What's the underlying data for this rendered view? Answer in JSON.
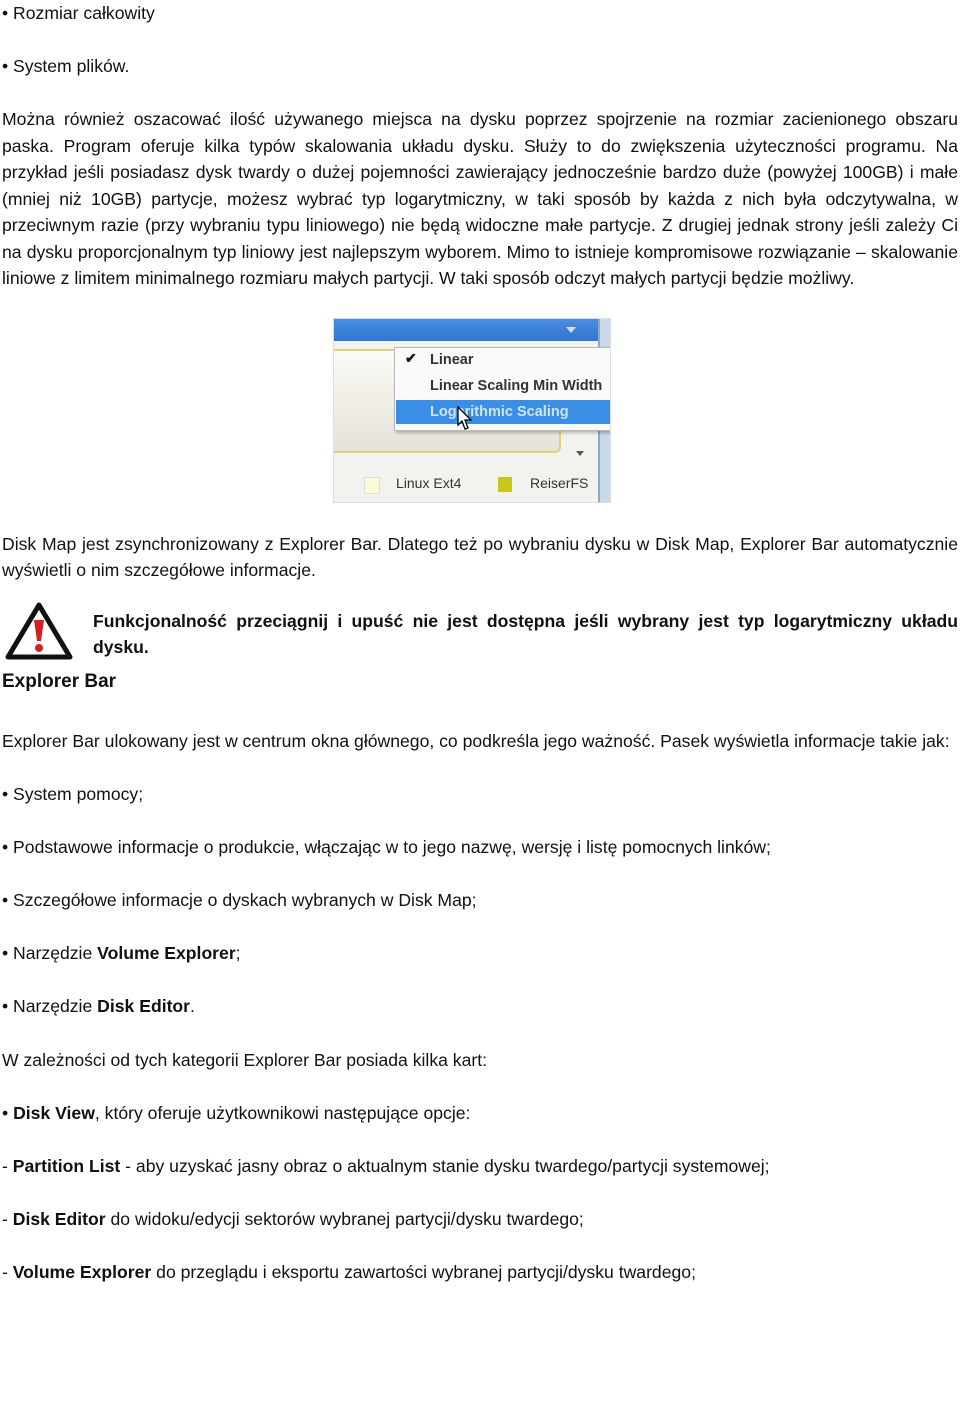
{
  "bullets_top": [
    "• Rozmiar całkowity",
    "• System plików."
  ],
  "para1": "Można również oszacować ilość używanego miejsca na dysku poprzez spojrzenie na rozmiar zacienionego obszaru paska. Program oferuje kilka typów skalowania układu dysku. Służy to do zwiększenia użyteczności programu. Na przykład jeśli posiadasz dysk twardy o dużej pojemności zawierający jednocześnie bardzo duże (powyżej 100GB) i małe (mniej niż 10GB) partycje, możesz wybrać typ logarytmiczny,  w taki sposób by każda z nich była odczytywalna, w przeciwnym razie (przy wybraniu typu liniowego) nie będą widoczne małe partycje. Z drugiej jednak strony jeśli zależy Ci na dysku proporcjonalnym typ liniowy jest najlepszym wyborem. Mimo to istnieje kompromisowe rozwiązanie – skalowanie liniowe z limitem minimalnego rozmiaru małych partycji. W taki sposób odczyt małych partycji będzie możliwy.",
  "figure": {
    "menu_items": [
      "Linear",
      "Linear Scaling Min Width",
      "Logarithmic Scaling"
    ],
    "checked_item": "Linear",
    "highlighted_item": "Logarithmic Scaling",
    "legend": [
      {
        "label": "Linux Ext4",
        "color": "#fbfbd8"
      },
      {
        "label": "ReiserFS",
        "color": "#c8c81a"
      }
    ]
  },
  "para2": "Disk Map jest zsynchronizowany z Explorer Bar. Dlatego też po wybraniu dysku w Disk Map, Explorer Bar automatycznie wyświetli o nim szczegółowe informacje.",
  "warning": "Funkcjonalność przeciągnij i upuść nie jest dostępna jeśli wybrany jest typ logarytmiczny układu dysku.",
  "heading": "Explorer Bar",
  "para3": "Explorer Bar ulokowany jest w centrum okna głównego, co podkreśla jego ważność. Pasek wyświetla informacje takie jak:",
  "list1": [
    {
      "pre": "• System pomocy;",
      "bold": "",
      "post": ""
    },
    {
      "pre": "• Podstawowe informacje o produkcie, włączając w to jego nazwę, wersję i listę pomocnych linków;",
      "bold": "",
      "post": ""
    },
    {
      "pre": "• Szczegółowe informacje o dyskach wybranych w  Disk Map;",
      "bold": "",
      "post": ""
    },
    {
      "pre": "• Narzędzie ",
      "bold": "Volume Explorer",
      "post": ";"
    },
    {
      "pre": "• Narzędzie ",
      "bold": "Disk Editor",
      "post": "."
    }
  ],
  "para4": "W zależności od tych kategorii Explorer Bar posiada kilka kart:",
  "list2": [
    {
      "pre": "• ",
      "bold": "Disk View",
      "post": ", który oferuje użytkownikowi następujące opcje:"
    },
    {
      "pre": "- ",
      "bold": "Partition List",
      "post": " - aby uzyskać jasny obraz o aktualnym stanie dysku twardego/partycji systemowej;"
    },
    {
      "pre": "- ",
      "bold": "Disk Editor",
      "post": " do widoku/edycji sektorów wybranej partycji/dysku twardego;"
    },
    {
      "pre": "- ",
      "bold": "Volume Explorer",
      "post": " do przeglądu i eksportu zawartości wybranej partycji/dysku twardego;"
    }
  ]
}
